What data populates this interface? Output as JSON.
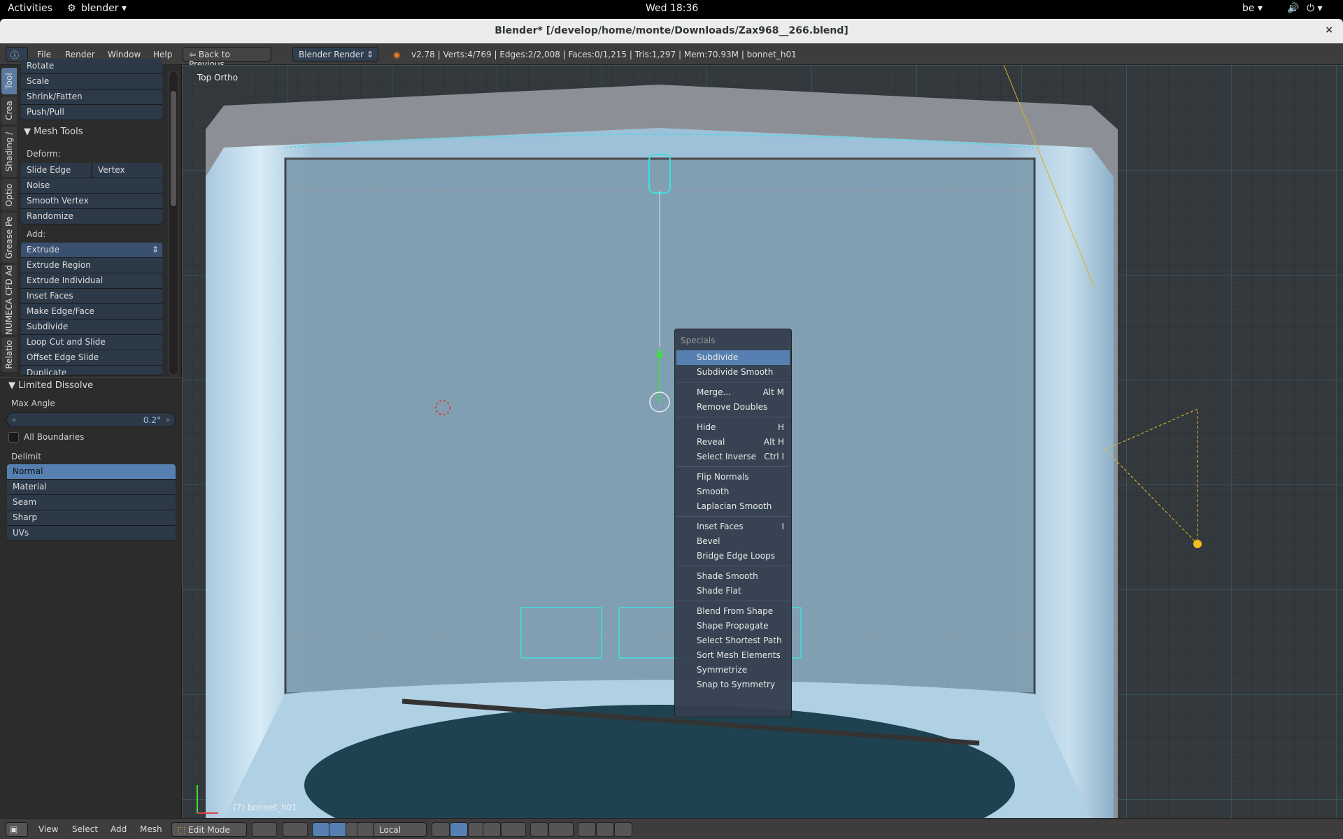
{
  "os_bar": {
    "activities": "Activities",
    "app": "blender",
    "clock": "Wed 18:36",
    "keyboard": "be",
    "app_icon": "blender-icon"
  },
  "window": {
    "title": "Blender* [/develop/home/monte/Downloads/Zax968__266.blend]",
    "close": "×"
  },
  "info_header": {
    "menus": [
      "File",
      "Render",
      "Window",
      "Help"
    ],
    "back_button": "Back to Previous",
    "engine": "Blender Render",
    "stats": "v2.78 | Verts:4/769 | Edges:2/2,008 | Faces:0/1,215 | Tris:1,297 | Mem:70.93M | bonnet_h01"
  },
  "tabs": [
    "Tool",
    "Crea",
    "Shading /",
    "Optio",
    "Grease Pe",
    "NUMECA CFD Ad",
    "Relatio"
  ],
  "tool_shelf": {
    "transform_items": [
      "Rotate",
      "Scale",
      "Shrink/Fatten",
      "Push/Pull"
    ],
    "mesh_tools": {
      "title": "Mesh Tools",
      "deform_label": "Deform:",
      "slide_edge": "Slide Edge",
      "vertex": "Vertex",
      "deform_items": [
        "Noise",
        "Smooth Vertex",
        "Randomize"
      ],
      "add_label": "Add:",
      "extrude": "Extrude",
      "add_items": [
        "Extrude Region",
        "Extrude Individual",
        "Inset Faces",
        "Make Edge/Face",
        "Subdivide",
        "Loop Cut and Slide",
        "Offset Edge Slide",
        "Duplicate"
      ]
    }
  },
  "operator": {
    "title": "Limited Dissolve",
    "max_angle_label": "Max Angle",
    "max_angle": "0.2°",
    "all_boundaries": "All Boundaries",
    "all_boundaries_checked": false,
    "delimit_label": "Delimit",
    "delimit": [
      "Normal",
      "Material",
      "Seam",
      "Sharp",
      "UVs"
    ],
    "delimit_selected": "Normal"
  },
  "viewport": {
    "view_label": "Top Ortho",
    "object_label": "(7) bonnet_h01"
  },
  "specials_menu": {
    "title": "Specials",
    "groups": [
      [
        {
          "label": "Subdivide",
          "shortcut": "",
          "highlighted": true
        },
        {
          "label": "Subdivide Smooth",
          "shortcut": ""
        }
      ],
      [
        {
          "label": "Merge...",
          "shortcut": "Alt M"
        },
        {
          "label": "Remove Doubles",
          "shortcut": ""
        }
      ],
      [
        {
          "label": "Hide",
          "shortcut": "H"
        },
        {
          "label": "Reveal",
          "shortcut": "Alt H"
        },
        {
          "label": "Select Inverse",
          "shortcut": "Ctrl I"
        }
      ],
      [
        {
          "label": "Flip Normals",
          "shortcut": ""
        },
        {
          "label": "Smooth",
          "shortcut": ""
        },
        {
          "label": "Laplacian Smooth",
          "shortcut": ""
        }
      ],
      [
        {
          "label": "Inset Faces",
          "shortcut": "I"
        },
        {
          "label": "Bevel",
          "shortcut": ""
        },
        {
          "label": "Bridge Edge Loops",
          "shortcut": ""
        }
      ],
      [
        {
          "label": "Shade Smooth",
          "shortcut": ""
        },
        {
          "label": "Shade Flat",
          "shortcut": ""
        }
      ],
      [
        {
          "label": "Blend From Shape",
          "shortcut": ""
        },
        {
          "label": "Shape Propagate",
          "shortcut": ""
        },
        {
          "label": "Select Shortest Path",
          "shortcut": ""
        },
        {
          "label": "Sort Mesh Elements",
          "shortcut": ""
        },
        {
          "label": "Symmetrize",
          "shortcut": ""
        },
        {
          "label": "Snap to Symmetry",
          "shortcut": ""
        }
      ]
    ]
  },
  "bottom_header": {
    "menus": [
      "View",
      "Select",
      "Add",
      "Mesh"
    ],
    "mode": "Edit Mode",
    "orientation": "Local"
  },
  "colors": {
    "accent": "#5680b2",
    "panel": "#2c3a48",
    "selection": "#00ffff",
    "light": "#f0c020"
  }
}
